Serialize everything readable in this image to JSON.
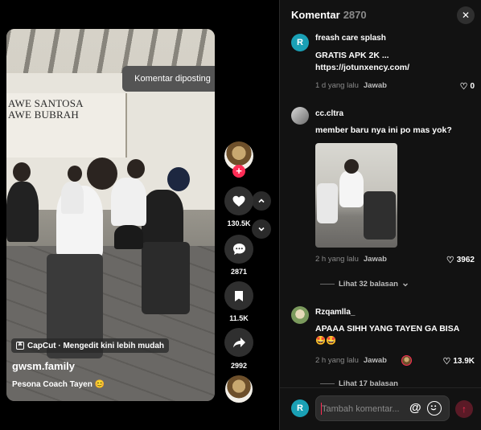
{
  "video": {
    "sign_text": "AWE SANTOSA\nAWE BUBRAH",
    "capcut_label": "CapCut · Mengedit kini lebih mudah",
    "author": "gwsm.family",
    "caption": "Pesona Coach Tayen 😊",
    "toast": "Komentar diposting"
  },
  "actions": {
    "likes": "130.5K",
    "comments": "2871",
    "saves": "11.5K",
    "shares": "2992",
    "follow_symbol": "+"
  },
  "panel": {
    "title": "Komentar",
    "count": "2870",
    "close_symbol": "✕"
  },
  "comments": [
    {
      "avatar": "R",
      "avatar_color": "#1aa0b5",
      "user": "freash care splash",
      "text": "GRATIS APK 2K ... https://jotunxency.com/",
      "time": "1 d yang lalu",
      "reply": "Jawab",
      "likes": "0"
    },
    {
      "avatar": "",
      "avatar_color": "#9a9a9a",
      "user": "cc.cltra",
      "text": "member baru nya ini po mas yok?",
      "time": "2 h yang lalu",
      "reply": "Jawab",
      "likes": "3962",
      "replies": "Lihat 32 balasan"
    },
    {
      "avatar": "",
      "avatar_color": "#c7b48a",
      "user": "Rzqamlla_",
      "text": "APAAA SIHH YANG TAYEN GA BISA 🤩🤩",
      "time": "2 h yang lalu",
      "reply": "Jawab",
      "likes": "13.9K",
      "replies": "Lihat 17 balasan"
    }
  ],
  "composer": {
    "avatar": "R",
    "placeholder": "Tambah komentar...",
    "at_symbol": "@",
    "send_symbol": "↑"
  },
  "colors": {
    "accent": "#fe2c55",
    "panel_bg": "#121212",
    "muted": "#8a8a8a"
  }
}
